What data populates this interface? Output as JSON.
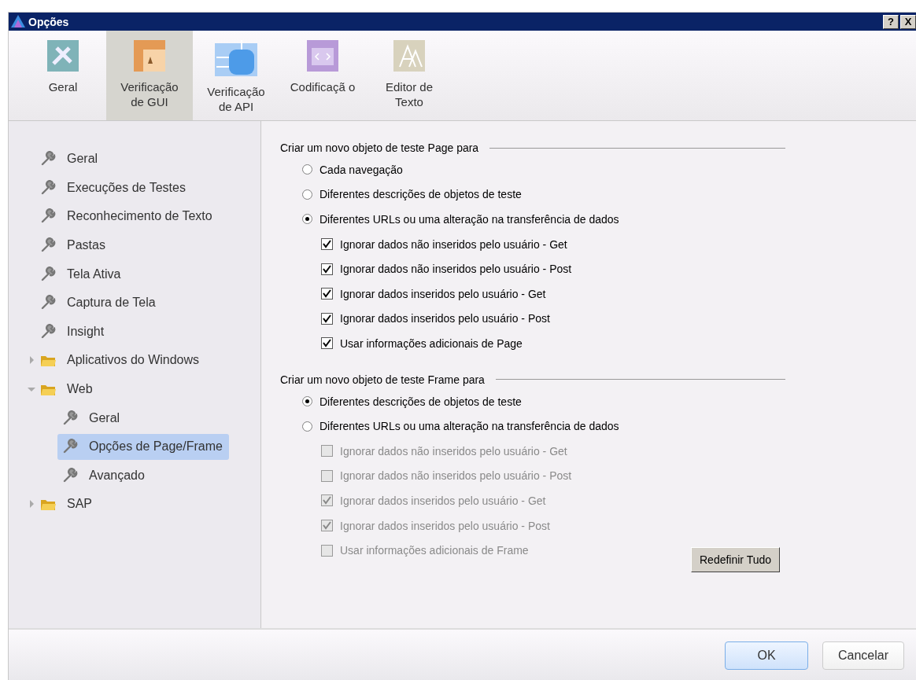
{
  "window": {
    "title": "Opções",
    "buttons": [
      "?",
      "X"
    ]
  },
  "tabs": [
    {
      "label": "Geral",
      "selected": false
    },
    {
      "label": "Verificação de GUI",
      "selected": true
    },
    {
      "label": "Verificação de API",
      "selected": false
    },
    {
      "label": "Codificaçã o",
      "selected": false
    },
    {
      "label": "Editor de Texto",
      "selected": false
    }
  ],
  "tree": [
    {
      "label": "Geral",
      "kind": "wrench",
      "selected": false
    },
    {
      "label": "Execuções de Testes",
      "kind": "wrench",
      "selected": false
    },
    {
      "label": "Reconhecimento de Texto",
      "kind": "wrench",
      "selected": false
    },
    {
      "label": "Pastas",
      "kind": "wrench",
      "selected": false
    },
    {
      "label": "Tela Ativa",
      "kind": "wrench",
      "selected": false
    },
    {
      "label": "Captura de Tela",
      "kind": "wrench",
      "selected": false
    },
    {
      "label": "Insight",
      "kind": "wrench",
      "selected": false
    },
    {
      "label": "Aplicativos do Windows",
      "kind": "folder",
      "expanded": false,
      "selected": false
    },
    {
      "label": "Web",
      "kind": "folder",
      "expanded": true,
      "selected": false,
      "children": [
        {
          "label": "Geral",
          "kind": "wrench",
          "selected": false
        },
        {
          "label": "Opções de Page/Frame",
          "kind": "wrench",
          "selected": true
        },
        {
          "label": "Avançado",
          "kind": "wrench",
          "selected": false
        }
      ]
    },
    {
      "label": "SAP",
      "kind": "folder",
      "expanded": false,
      "selected": false
    }
  ],
  "sections": [
    {
      "title": "Criar um novo objeto de teste Page para",
      "options": [
        {
          "kind": "radio",
          "label": "Cada navegação",
          "checked": false
        },
        {
          "kind": "radio",
          "label": "Diferentes descrições de objetos de teste",
          "checked": false
        },
        {
          "kind": "radio",
          "label": "Diferentes URLs ou uma alteração na transferência de dados",
          "checked": true,
          "children": [
            {
              "kind": "checkbox",
              "label": "Ignorar dados não inseridos pelo usuário - Get",
              "checked": true,
              "disabled": false
            },
            {
              "kind": "checkbox",
              "label": "Ignorar dados não inseridos pelo usuário - Post",
              "checked": true,
              "disabled": false
            },
            {
              "kind": "checkbox",
              "label": "Ignorar dados inseridos pelo usuário - Get",
              "checked": true,
              "disabled": false
            },
            {
              "kind": "checkbox",
              "label": "Ignorar dados inseridos pelo usuário - Post",
              "checked": true,
              "disabled": false
            },
            {
              "kind": "checkbox",
              "label": "Usar informações adicionais de Page",
              "checked": true,
              "disabled": false
            }
          ]
        }
      ]
    },
    {
      "title": "Criar um novo objeto de teste Frame para",
      "options": [
        {
          "kind": "radio",
          "label": "Diferentes descrições de objetos de teste",
          "checked": true
        },
        {
          "kind": "radio",
          "label": "Diferentes URLs ou uma alteração na transferência de dados",
          "checked": false,
          "children": [
            {
              "kind": "checkbox",
              "label": "Ignorar dados não inseridos pelo usuário - Get",
              "checked": false,
              "disabled": true
            },
            {
              "kind": "checkbox",
              "label": "Ignorar dados não inseridos pelo usuário - Post",
              "checked": false,
              "disabled": true
            },
            {
              "kind": "checkbox",
              "label": "Ignorar dados inseridos pelo usuário - Get",
              "checked": true,
              "disabled": true
            },
            {
              "kind": "checkbox",
              "label": "Ignorar dados inseridos pelo usuário - Post",
              "checked": true,
              "disabled": true
            },
            {
              "kind": "checkbox",
              "label": "Usar informações adicionais de Frame",
              "checked": false,
              "disabled": true
            }
          ]
        }
      ]
    }
  ],
  "reset_button": "Redefinir Tudo",
  "footer_buttons": [
    {
      "label": "OK",
      "kind": "primary"
    },
    {
      "label": "Cancelar",
      "kind": "normal"
    }
  ]
}
